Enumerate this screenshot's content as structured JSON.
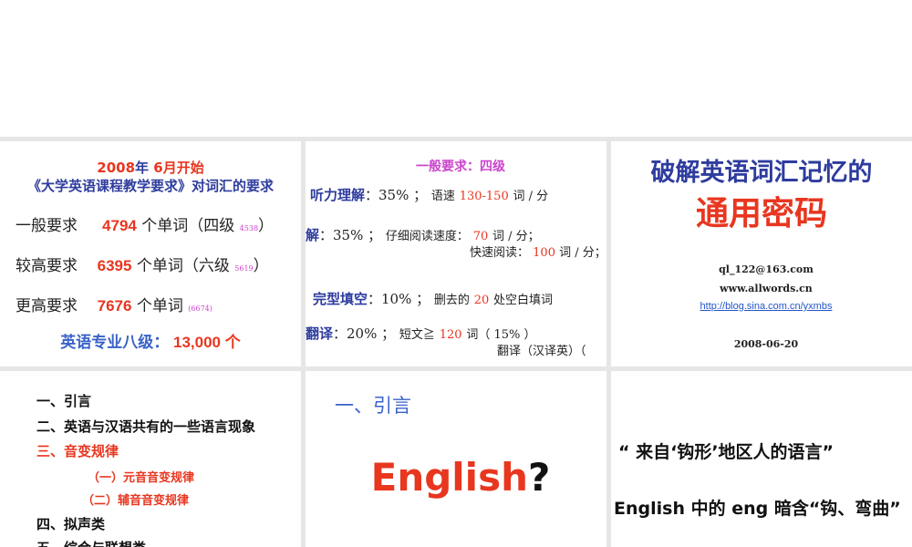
{
  "slide1": {
    "line1_year": "2008",
    "line1_year_suffix": "年",
    "line1_month": "6",
    "line1_rest": "月开始",
    "line2": "《大学英语课程教学要求》对词汇的要求",
    "rows": [
      {
        "label": "一般要求",
        "num": "4794",
        "unit": "个单词（四级",
        "small": "4538",
        "close": "）"
      },
      {
        "label": "较高要求",
        "num": "6395",
        "unit": "个单词（六级",
        "small": "5619",
        "close": "）"
      },
      {
        "label": "更高要求",
        "num": "7676",
        "unit": "个单词",
        "small": "(6674)",
        "close": ""
      }
    ],
    "last_label": "英语专业八级：",
    "last_value": "13,000 个"
  },
  "slide2": {
    "title": "一般要求：四级",
    "listening_label": "听力理解",
    "listening_pct": "：35% ；",
    "listening_speed_label": "语速",
    "listening_speed": "130-150",
    "listening_unit": "词 / 分",
    "reading_label": "解",
    "reading_pct": "：35% ；",
    "reading_careful_label": "仔细阅读速度：",
    "reading_careful": "70",
    "reading_careful_unit": "词 / 分；",
    "reading_fast_label": "快速阅读：",
    "reading_fast": "100",
    "reading_fast_unit": "词 / 分；",
    "cloze_label": "完型填空",
    "cloze_pct": "：10% ；",
    "cloze_text1": "删去的",
    "cloze_num": "20",
    "cloze_text2": "处空白填词",
    "trans_label": "翻译",
    "trans_pct": "：20% ；",
    "trans_text1": "短文≧",
    "trans_num": "120",
    "trans_text2": "词（ 15% ）",
    "trans_text3": "翻译（汉译英）（"
  },
  "slide3": {
    "title_line1": "破解英语词汇记忆的",
    "title_line2": "通用密码",
    "email": "ql_122@163.com",
    "site": "www.allwords.cn",
    "blog": "http://blog.sina.com.cn/yxmbs",
    "date": "2008-06-20"
  },
  "slide4": {
    "items": [
      "一、引言",
      "二、英语与汉语共有的一些语言现象",
      "三、音变规律",
      "（一）元音音变规律",
      "（二）辅音音变规律",
      "四、拟声类",
      "五、综合与联想类"
    ]
  },
  "slide5": {
    "section": "一、引言",
    "word": "English",
    "mark": "?"
  },
  "slide6": {
    "quote1": "“ 来自‘钩形’地区人的语言”",
    "quote2": "English 中的 eng 暗含“钩、弯曲”"
  }
}
